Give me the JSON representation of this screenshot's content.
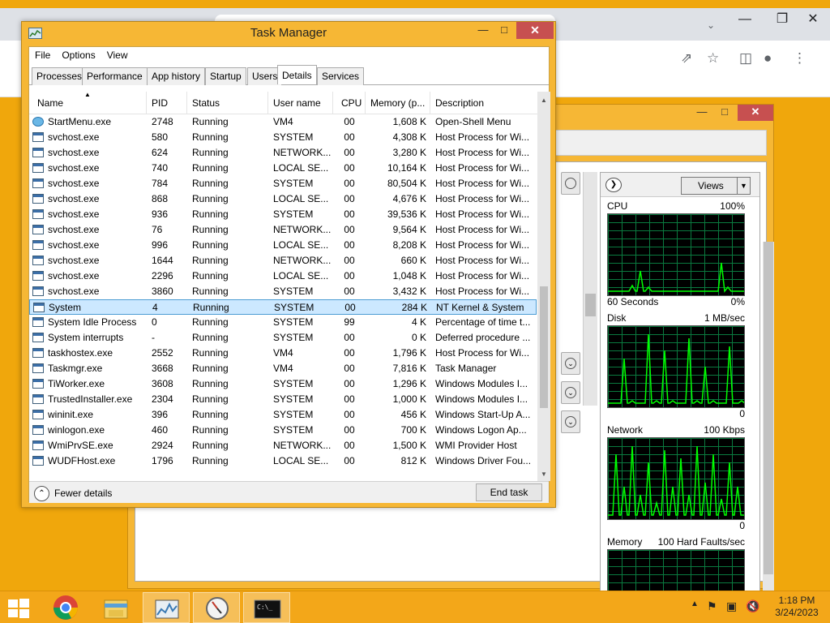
{
  "window": {
    "title": "Task Manager"
  },
  "menu": [
    "File",
    "Options",
    "View"
  ],
  "tabs": [
    "Processes",
    "Performance",
    "App history",
    "Startup",
    "Users",
    "Details",
    "Services"
  ],
  "active_tab": "Details",
  "columns": [
    "Name",
    "PID",
    "Status",
    "User name",
    "CPU",
    "Memory (p...",
    "Description"
  ],
  "rows": [
    {
      "name": "StartMenu.exe",
      "pid": "2748",
      "status": "Running",
      "user": "VM4",
      "cpu": "00",
      "mem": "1,608 K",
      "desc": "Open-Shell Menu"
    },
    {
      "name": "svchost.exe",
      "pid": "580",
      "status": "Running",
      "user": "SYSTEM",
      "cpu": "00",
      "mem": "4,308 K",
      "desc": "Host Process for Wi..."
    },
    {
      "name": "svchost.exe",
      "pid": "624",
      "status": "Running",
      "user": "NETWORK...",
      "cpu": "00",
      "mem": "3,280 K",
      "desc": "Host Process for Wi..."
    },
    {
      "name": "svchost.exe",
      "pid": "740",
      "status": "Running",
      "user": "LOCAL SE...",
      "cpu": "00",
      "mem": "10,164 K",
      "desc": "Host Process for Wi..."
    },
    {
      "name": "svchost.exe",
      "pid": "784",
      "status": "Running",
      "user": "SYSTEM",
      "cpu": "00",
      "mem": "80,504 K",
      "desc": "Host Process for Wi..."
    },
    {
      "name": "svchost.exe",
      "pid": "868",
      "status": "Running",
      "user": "LOCAL SE...",
      "cpu": "00",
      "mem": "4,676 K",
      "desc": "Host Process for Wi..."
    },
    {
      "name": "svchost.exe",
      "pid": "936",
      "status": "Running",
      "user": "SYSTEM",
      "cpu": "00",
      "mem": "39,536 K",
      "desc": "Host Process for Wi..."
    },
    {
      "name": "svchost.exe",
      "pid": "76",
      "status": "Running",
      "user": "NETWORK...",
      "cpu": "00",
      "mem": "9,564 K",
      "desc": "Host Process for Wi..."
    },
    {
      "name": "svchost.exe",
      "pid": "996",
      "status": "Running",
      "user": "LOCAL SE...",
      "cpu": "00",
      "mem": "8,208 K",
      "desc": "Host Process for Wi..."
    },
    {
      "name": "svchost.exe",
      "pid": "1644",
      "status": "Running",
      "user": "NETWORK...",
      "cpu": "00",
      "mem": "660 K",
      "desc": "Host Process for Wi..."
    },
    {
      "name": "svchost.exe",
      "pid": "2296",
      "status": "Running",
      "user": "LOCAL SE...",
      "cpu": "00",
      "mem": "1,048 K",
      "desc": "Host Process for Wi..."
    },
    {
      "name": "svchost.exe",
      "pid": "3860",
      "status": "Running",
      "user": "SYSTEM",
      "cpu": "00",
      "mem": "3,432 K",
      "desc": "Host Process for Wi..."
    },
    {
      "name": "System",
      "pid": "4",
      "status": "Running",
      "user": "SYSTEM",
      "cpu": "00",
      "mem": "284 K",
      "desc": "NT Kernel & System",
      "selected": true
    },
    {
      "name": "System Idle Process",
      "pid": "0",
      "status": "Running",
      "user": "SYSTEM",
      "cpu": "99",
      "mem": "4 K",
      "desc": "Percentage of time t..."
    },
    {
      "name": "System interrupts",
      "pid": "-",
      "status": "Running",
      "user": "SYSTEM",
      "cpu": "00",
      "mem": "0 K",
      "desc": "Deferred procedure ..."
    },
    {
      "name": "taskhostex.exe",
      "pid": "2552",
      "status": "Running",
      "user": "VM4",
      "cpu": "00",
      "mem": "1,796 K",
      "desc": "Host Process for Wi..."
    },
    {
      "name": "Taskmgr.exe",
      "pid": "3668",
      "status": "Running",
      "user": "VM4",
      "cpu": "00",
      "mem": "7,816 K",
      "desc": "Task Manager"
    },
    {
      "name": "TiWorker.exe",
      "pid": "3608",
      "status": "Running",
      "user": "SYSTEM",
      "cpu": "00",
      "mem": "1,296 K",
      "desc": "Windows Modules I..."
    },
    {
      "name": "TrustedInstaller.exe",
      "pid": "2304",
      "status": "Running",
      "user": "SYSTEM",
      "cpu": "00",
      "mem": "1,000 K",
      "desc": "Windows Modules I..."
    },
    {
      "name": "wininit.exe",
      "pid": "396",
      "status": "Running",
      "user": "SYSTEM",
      "cpu": "00",
      "mem": "456 K",
      "desc": "Windows Start-Up A..."
    },
    {
      "name": "winlogon.exe",
      "pid": "460",
      "status": "Running",
      "user": "SYSTEM",
      "cpu": "00",
      "mem": "700 K",
      "desc": "Windows Logon Ap..."
    },
    {
      "name": "WmiPrvSE.exe",
      "pid": "2924",
      "status": "Running",
      "user": "NETWORK...",
      "cpu": "00",
      "mem": "1,500 K",
      "desc": "WMI Provider Host"
    },
    {
      "name": "WUDFHost.exe",
      "pid": "1796",
      "status": "Running",
      "user": "LOCAL SE...",
      "cpu": "00",
      "mem": "812 K",
      "desc": "Windows Driver Fou..."
    }
  ],
  "footer": {
    "fewer_details": "Fewer details",
    "end_task": "End task"
  },
  "resmon": {
    "views_label": "Views",
    "graphs": [
      {
        "label": "CPU",
        "max": "100%",
        "footer_left": "60 Seconds",
        "footer_right": "0%"
      },
      {
        "label": "Disk",
        "max": "1 MB/sec",
        "footer_left": "",
        "footer_right": "0"
      },
      {
        "label": "Network",
        "max": "100 Kbps",
        "footer_left": "",
        "footer_right": "0"
      },
      {
        "label": "Memory",
        "max": "100 Hard Faults/sec",
        "footer_left": "",
        "footer_right": ""
      }
    ]
  },
  "taskbar": {
    "time": "1:18 PM",
    "date": "3/24/2023",
    "apps": [
      "chrome-icon",
      "file-explorer-icon",
      "resource-monitor-icon",
      "clock-app-icon",
      "command-prompt-icon"
    ]
  },
  "colors": {
    "accent": "#f6b735",
    "selection": "#cce8ff",
    "close": "#c75050",
    "graph_line": "#00ff00"
  }
}
